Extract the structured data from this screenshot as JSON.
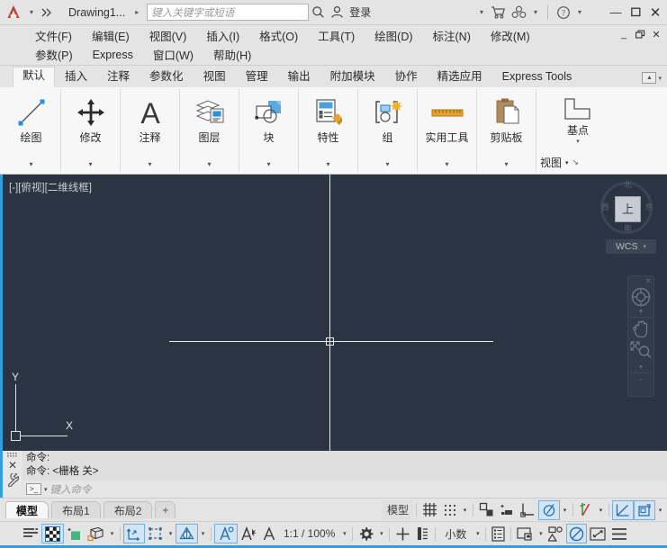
{
  "titlebar": {
    "app_icon": "autocad-a-logo",
    "qat_dropdown": "▾",
    "qat_more": "▸▸",
    "document_title": "Drawing1...",
    "doc_caret": "▸",
    "search_placeholder": "键入关键字或短语",
    "search_icon": "search-icon",
    "account_icon": "user-account-icon",
    "login_label": "登录",
    "login_caret": "▾",
    "store_icon": "cart-icon",
    "autodesk_icon": "autodesk-a360-icon",
    "autodesk_caret": "▾",
    "help_icon": "help-question-icon",
    "help_caret": "▾",
    "minimize": "—",
    "maximize": "▭",
    "close": "✕"
  },
  "menubar": {
    "row1": [
      "文件(F)",
      "编辑(E)",
      "视图(V)",
      "插入(I)",
      "格式(O)",
      "工具(T)",
      "绘图(D)",
      "标注(N)",
      "修改(M)"
    ],
    "row2": [
      "参数(P)",
      "Express",
      "窗口(W)",
      "帮助(H)"
    ],
    "mini_minimize": "_",
    "mini_restore": "❐",
    "mini_close": "✕"
  },
  "ribbon": {
    "tabs": [
      {
        "label": "默认",
        "active": true
      },
      {
        "label": "插入",
        "active": false
      },
      {
        "label": "注释",
        "active": false
      },
      {
        "label": "参数化",
        "active": false
      },
      {
        "label": "视图",
        "active": false
      },
      {
        "label": "管理",
        "active": false
      },
      {
        "label": "输出",
        "active": false
      },
      {
        "label": "附加模块",
        "active": false
      },
      {
        "label": "协作",
        "active": false
      },
      {
        "label": "精选应用",
        "active": false
      },
      {
        "label": "Express Tools",
        "active": false
      }
    ],
    "minimize_caret": "▾",
    "panels": [
      {
        "label": "绘图",
        "icon": "line-draw-icon",
        "caret": "▾"
      },
      {
        "label": "修改",
        "icon": "move-arrows-icon",
        "caret": "▾"
      },
      {
        "label": "注释",
        "icon": "text-a-icon",
        "caret": "▾"
      },
      {
        "label": "图层",
        "icon": "layers-icon",
        "caret": "▾"
      },
      {
        "label": "块",
        "icon": "block-icon",
        "caret": "▾"
      },
      {
        "label": "特性",
        "icon": "properties-icon",
        "caret": "▾"
      },
      {
        "label": "组",
        "icon": "group-icon",
        "caret": "▾"
      },
      {
        "label": "实用工具",
        "icon": "ruler-icon",
        "caret": "▾"
      },
      {
        "label": "剪贴板",
        "icon": "clipboard-icon",
        "caret": "▾"
      },
      {
        "label": "基点",
        "icon": "basepoint-icon",
        "caret": "▾"
      }
    ],
    "view_label": "视图",
    "view_caret": "▾",
    "view_launcher": "↘"
  },
  "canvas": {
    "viewport_label": "[-][俯视][二维线框]",
    "ucs_x_label": "X",
    "ucs_y_label": "Y",
    "viewcube": {
      "face_label": "上",
      "north": "北",
      "south": "南",
      "west": "西",
      "east": "东",
      "wcs_label": "WCS",
      "wcs_caret": "▾"
    },
    "navbar": {
      "close_icon": "nav-close-icon",
      "items": [
        "steering-wheel-icon",
        "pan-hand-icon",
        "zoom-extents-icon",
        "orbit-icon"
      ],
      "caret": "▾",
      "more_caret": "⌄"
    }
  },
  "commandline": {
    "grip_icon": "drag-grip-icon",
    "close_icon": "close-icon",
    "settings_icon": "wrench-icon",
    "history": [
      "命令:",
      "命令:  <栅格 关>"
    ],
    "prompt_icon": "command-prompt-icon",
    "prompt_caret": "▾",
    "input_placeholder": "键入命令"
  },
  "layout_tabs": {
    "tabs": [
      {
        "label": "模型",
        "active": true
      },
      {
        "label": "布局1",
        "active": false
      },
      {
        "label": "布局2",
        "active": false
      }
    ],
    "add_label": "+"
  },
  "status_tabrow": {
    "model_label": "模型",
    "items": [
      {
        "name": "grid-display-toggle",
        "icon": "grid-icon",
        "on": false,
        "caret": false
      },
      {
        "name": "snap-mode-toggle",
        "icon": "snap-dots-icon",
        "on": false,
        "caret": true
      },
      {
        "name": "ortho-mode-toggle",
        "icon": "ortho-icon",
        "on": false,
        "caret": false
      },
      {
        "name": "polar-tracking-toggle",
        "icon": "polar-icon",
        "on": false,
        "caret": false
      },
      {
        "name": "object-snap-tracking-toggle",
        "icon": "osnap-track-icon",
        "on": false,
        "caret": false
      },
      {
        "name": "object-snap-toggle",
        "icon": "object-snap-icon",
        "on": true,
        "caret": true
      },
      {
        "name": "3d-object-snap-toggle",
        "icon": "3d-osnap-icon",
        "on": false,
        "caret": true
      },
      {
        "name": "lineweight-toggle",
        "icon": "lineweight-icon",
        "on": true,
        "caret": false
      },
      {
        "name": "transparency-toggle",
        "icon": "transparency-icon",
        "on": true,
        "caret": true
      }
    ]
  },
  "statusbar": {
    "annotation_scale": "1:1 / 100%",
    "units_label": "小数",
    "units_caret": "▾",
    "items": [
      {
        "name": "quick-properties-toggle",
        "icon": "quick-props-icon",
        "on": false
      },
      {
        "name": "selection-cycling-toggle",
        "icon": "checker-icon",
        "on": true
      },
      {
        "name": "annotation-monitor-toggle",
        "icon": "annotation-monitor-icon",
        "on": false
      },
      {
        "name": "workspace-3d-icon",
        "icon": "cube-icon",
        "on": false
      },
      {
        "name": "dynamic-ucs-toggle",
        "icon": "dynamic-ucs-icon",
        "on": true
      },
      {
        "name": "selection-filter-icon",
        "icon": "selection-filter-icon",
        "on": false
      },
      {
        "name": "gizmo-icon",
        "icon": "gizmo-icon",
        "on": true
      },
      {
        "name": "annotation-visibility-icon",
        "icon": "annotation-visibility-icon",
        "on": true
      },
      {
        "name": "autoscale-icon",
        "icon": "autoscale-icon",
        "on": false
      },
      {
        "name": "annotation-scale-icon",
        "icon": "annotation-scale-icon",
        "on": false
      },
      {
        "name": "workspace-switching-icon",
        "icon": "gear-icon",
        "on": false
      },
      {
        "name": "annotation-add-icon",
        "icon": "plus-icon",
        "on": false
      },
      {
        "name": "layout-tools-icon",
        "icon": "layout-tools-icon",
        "on": false
      },
      {
        "name": "isolate-objects-icon",
        "icon": "isolate-objects-icon",
        "on": false
      },
      {
        "name": "hardware-acceleration-icon",
        "icon": "hardware-accel-icon",
        "on": true
      },
      {
        "name": "clean-screen-icon",
        "icon": "clean-screen-icon",
        "on": false
      },
      {
        "name": "customization-icon",
        "icon": "hamburger-icon",
        "on": false
      }
    ]
  },
  "colors": {
    "accent": "#2fa0dd",
    "canvas_bg": "#2b3442",
    "chrome_bg": "#e4e4e4",
    "ribbon_bg": "#f7f7f7",
    "toggle_on": "#d2e5f4",
    "logo_red": "#c0392b"
  }
}
